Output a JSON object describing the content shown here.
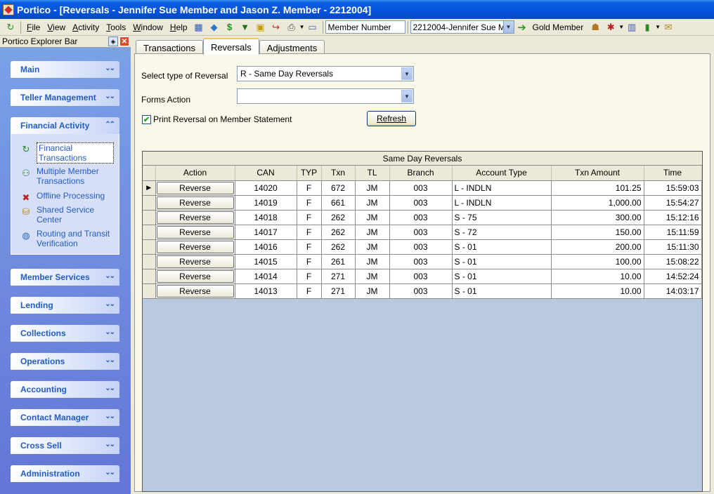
{
  "window": {
    "title": "Portico - [Reversals - Jennifer Sue Member and Jason Z. Member - 2212004]"
  },
  "menu": [
    {
      "label": "File",
      "ul": "F",
      "rest": "ile"
    },
    {
      "label": "View",
      "ul": "V",
      "rest": "iew"
    },
    {
      "label": "Activity",
      "ul": "A",
      "rest": "ctivity"
    },
    {
      "label": "Tools",
      "ul": "T",
      "rest": "ools"
    },
    {
      "label": "Window",
      "ul": "W",
      "rest": "indow"
    },
    {
      "label": "Help",
      "ul": "H",
      "rest": "elp"
    }
  ],
  "toolbar": {
    "search_type": "Member Number",
    "member_select": "2212004-Jennifer Sue M",
    "member_tier": "Gold Member"
  },
  "explorer": {
    "title": "Portico Explorer Bar",
    "groups": [
      "Main",
      "Teller Management",
      "Financial Activity",
      "Member Services",
      "Lending",
      "Collections",
      "Operations",
      "Accounting",
      "Contact Manager",
      "Cross Sell",
      "Administration"
    ],
    "financial_items": [
      "Financial Transactions",
      "Multiple Member Transactions",
      "Offline Processing",
      "Shared Service Center",
      "Routing and Transit Verification"
    ]
  },
  "tabs": [
    "Transactions",
    "Reversals",
    "Adjustments"
  ],
  "form": {
    "reversal_type_label": "Select type of Reversal",
    "reversal_type_value": "R - Same Day Reversals",
    "forms_action_label": "Forms Action",
    "forms_action_value": "",
    "print_label": "Print Reversal on Member Statement",
    "print_checked": true,
    "refresh_label": "Refresh"
  },
  "grid": {
    "caption": "Same Day Reversals",
    "columns": [
      "Action",
      "CAN",
      "TYP",
      "Txn",
      "TL",
      "Branch",
      "Account Type",
      "Txn Amount",
      "Time"
    ],
    "action_label": "Reverse",
    "rows": [
      {
        "can": "14020",
        "typ": "F",
        "txn": "672",
        "tl": "JM",
        "branch": "003",
        "acct": "L - INDLN",
        "amount": "101.25",
        "time": "15:59:03",
        "current": true
      },
      {
        "can": "14019",
        "typ": "F",
        "txn": "661",
        "tl": "JM",
        "branch": "003",
        "acct": "L - INDLN",
        "amount": "1,000.00",
        "time": "15:54:27"
      },
      {
        "can": "14018",
        "typ": "F",
        "txn": "262",
        "tl": "JM",
        "branch": "003",
        "acct": "S - 75",
        "amount": "300.00",
        "time": "15:12:16"
      },
      {
        "can": "14017",
        "typ": "F",
        "txn": "262",
        "tl": "JM",
        "branch": "003",
        "acct": "S - 72",
        "amount": "150.00",
        "time": "15:11:59"
      },
      {
        "can": "14016",
        "typ": "F",
        "txn": "262",
        "tl": "JM",
        "branch": "003",
        "acct": "S - 01",
        "amount": "200.00",
        "time": "15:11:30"
      },
      {
        "can": "14015",
        "typ": "F",
        "txn": "261",
        "tl": "JM",
        "branch": "003",
        "acct": "S - 01",
        "amount": "100.00",
        "time": "15:08:22"
      },
      {
        "can": "14014",
        "typ": "F",
        "txn": "271",
        "tl": "JM",
        "branch": "003",
        "acct": "S - 01",
        "amount": "10.00",
        "time": "14:52:24"
      },
      {
        "can": "14013",
        "typ": "F",
        "txn": "271",
        "tl": "JM",
        "branch": "003",
        "acct": "S - 01",
        "amount": "10.00",
        "time": "14:03:17"
      }
    ]
  }
}
